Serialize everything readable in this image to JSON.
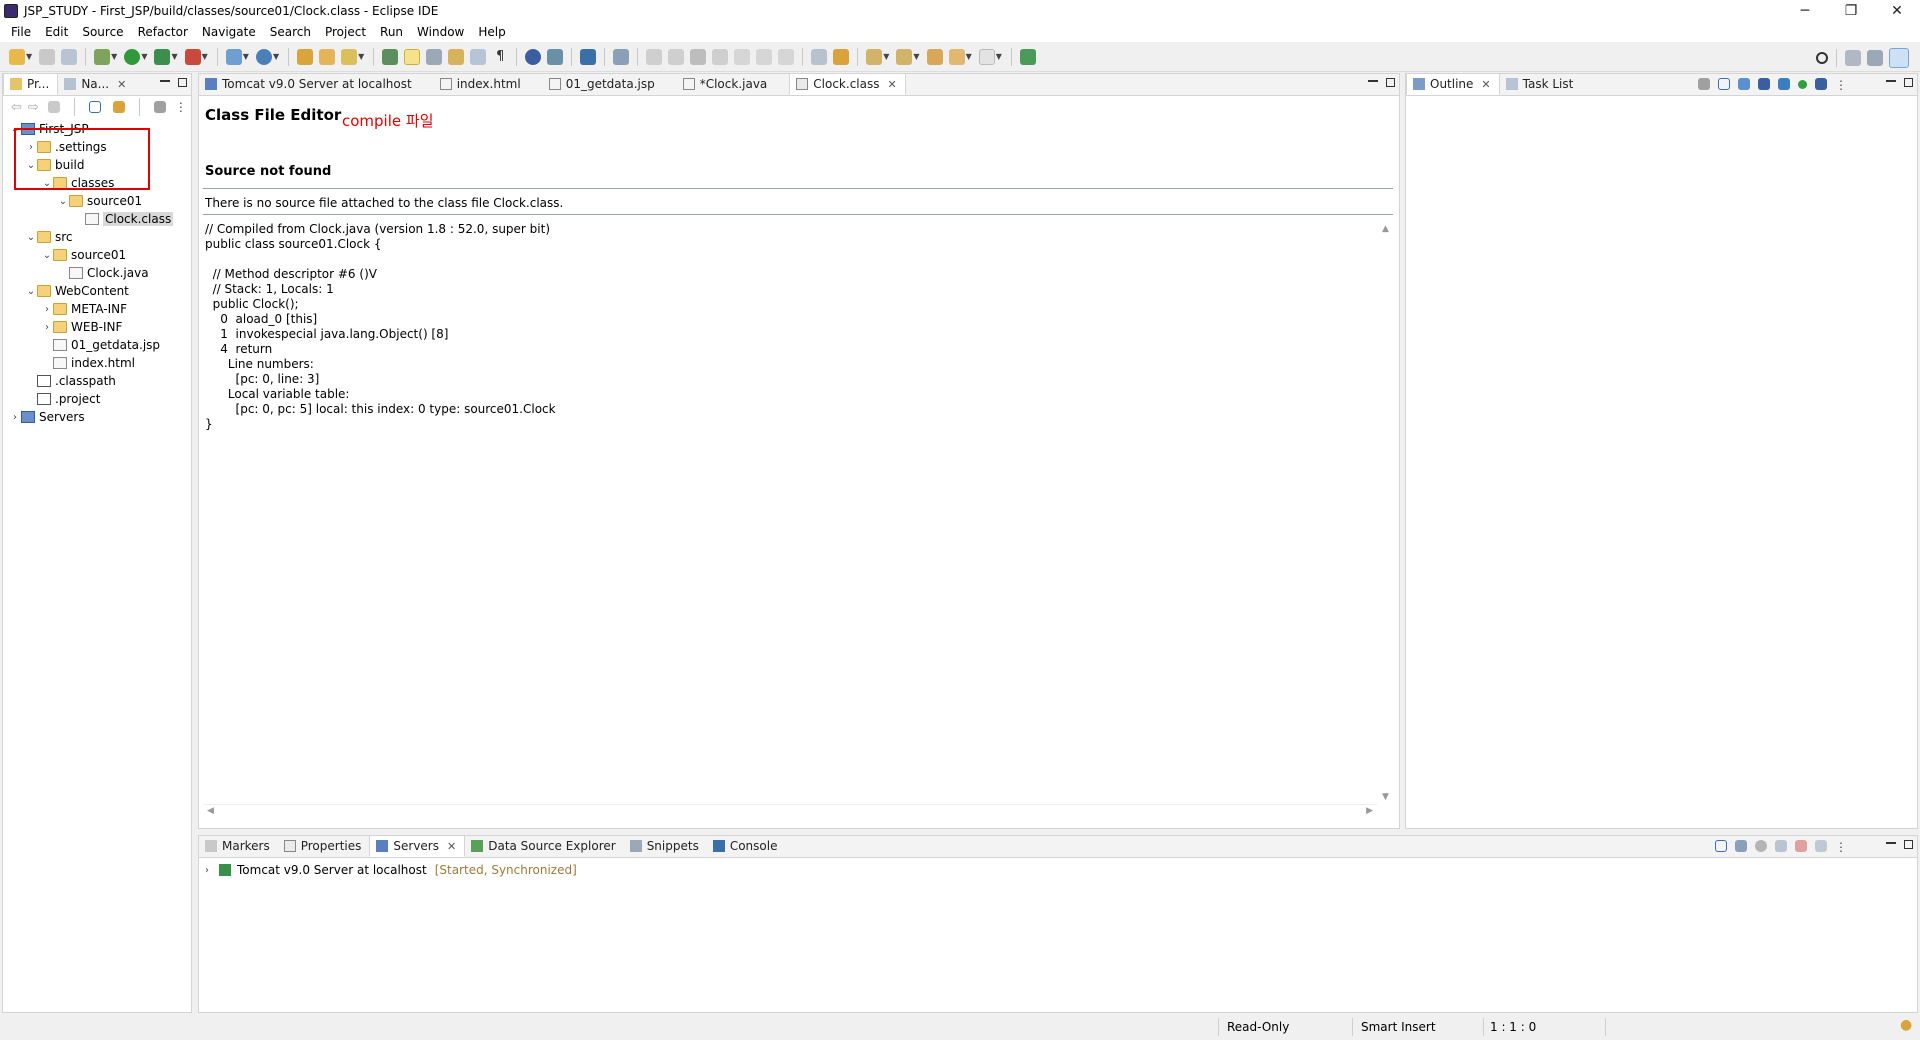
{
  "window": {
    "title": "JSP_STUDY - First_JSP/build/classes/source01/Clock.class - Eclipse IDE",
    "minimize": "─",
    "restore": "❐",
    "close": "✕"
  },
  "menu": [
    "File",
    "Edit",
    "Source",
    "Refactor",
    "Navigate",
    "Search",
    "Project",
    "Run",
    "Window",
    "Help"
  ],
  "explorer": {
    "tabs": [
      {
        "label": "Pr..."
      },
      {
        "label": "Na..."
      }
    ],
    "tree": [
      {
        "label": "First_JSP",
        "depth": 0,
        "icon": "project-icon",
        "expanded": true
      },
      {
        "label": ".settings",
        "depth": 1,
        "icon": "folder-icon",
        "expanded": false
      },
      {
        "label": "build",
        "depth": 1,
        "icon": "folder-icon",
        "expanded": true
      },
      {
        "label": "classes",
        "depth": 2,
        "icon": "folder-icon",
        "expanded": true
      },
      {
        "label": "source01",
        "depth": 3,
        "icon": "folder-icon",
        "expanded": true
      },
      {
        "label": "Clock.class",
        "depth": 4,
        "icon": "class-file-icon",
        "selected": true
      },
      {
        "label": "src",
        "depth": 1,
        "icon": "folder-icon",
        "expanded": true
      },
      {
        "label": "source01",
        "depth": 2,
        "icon": "folder-icon",
        "expanded": true
      },
      {
        "label": "Clock.java",
        "depth": 3,
        "icon": "java-file-icon"
      },
      {
        "label": "WebContent",
        "depth": 1,
        "icon": "folder-icon",
        "expanded": true
      },
      {
        "label": "META-INF",
        "depth": 2,
        "icon": "folder-icon",
        "expanded": false
      },
      {
        "label": "WEB-INF",
        "depth": 2,
        "icon": "folder-icon",
        "expanded": false
      },
      {
        "label": "01_getdata.jsp",
        "depth": 2,
        "icon": "jsp-file-icon"
      },
      {
        "label": "index.html",
        "depth": 2,
        "icon": "html-file-icon"
      },
      {
        "label": ".classpath",
        "depth": 1,
        "icon": "xml-file-icon"
      },
      {
        "label": ".project",
        "depth": 1,
        "icon": "xml-file-icon"
      },
      {
        "label": "Servers",
        "depth": 0,
        "icon": "project-icon",
        "expanded": false
      }
    ]
  },
  "editor": {
    "tabs": [
      {
        "label": "Tomcat v9.0 Server at localhost"
      },
      {
        "label": "index.html"
      },
      {
        "label": "01_getdata.jsp"
      },
      {
        "label": "*Clock.java"
      },
      {
        "label": "Clock.class",
        "active": true
      }
    ],
    "heading": "Class File Editor",
    "annotation": "compile 파일",
    "source_not_found": "Source not found",
    "no_source_msg": "There is no source file attached to the class file Clock.class.",
    "code": "// Compiled from Clock.java (version 1.8 : 52.0, super bit)\npublic class source01.Clock {\n  \n  // Method descriptor #6 ()V\n  // Stack: 1, Locals: 1\n  public Clock();\n    0  aload_0 [this]\n    1  invokespecial java.lang.Object() [8]\n    4  return\n      Line numbers:\n        [pc: 0, line: 3]\n      Local variable table:\n        [pc: 0, pc: 5] local: this index: 0 type: source01.Clock\n}"
  },
  "outline": {
    "tabs": [
      {
        "label": "Outline"
      },
      {
        "label": "Task List"
      }
    ]
  },
  "bottom": {
    "tabs": [
      {
        "label": "Markers"
      },
      {
        "label": "Properties"
      },
      {
        "label": "Servers",
        "active": true
      },
      {
        "label": "Data Source Explorer"
      },
      {
        "label": "Snippets"
      },
      {
        "label": "Console"
      }
    ],
    "server_name": "Tomcat v9.0 Server at localhost",
    "server_status": "[Started, Synchronized]"
  },
  "status": {
    "mode": "Read-Only",
    "insert": "Smart Insert",
    "position": "1 : 1 : 0"
  }
}
